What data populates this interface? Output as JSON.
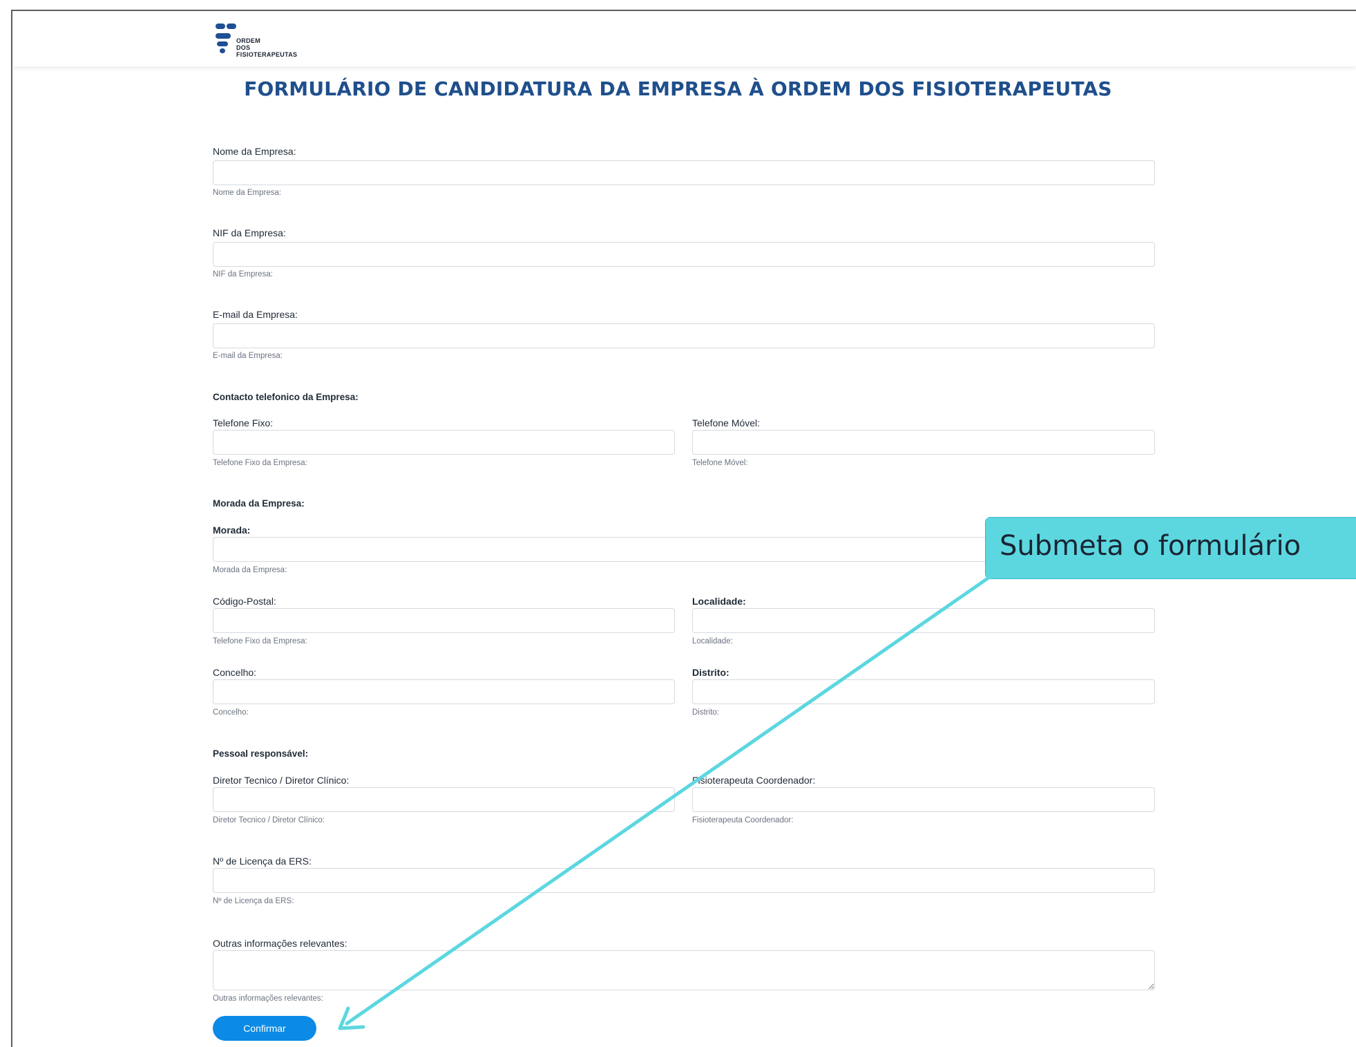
{
  "brand": {
    "logo_line1": "ORDEM",
    "logo_line2": "DOS",
    "logo_line3": "FISIOTERAPEUTAS"
  },
  "page": {
    "title": "FORMULÁRIO DE CANDIDATURA DA EMPRESA À ORDEM DOS FISIOTERAPEUTAS"
  },
  "form": {
    "nome": {
      "label": "Nome da Empresa:",
      "value": "",
      "help": "Nome da Empresa:"
    },
    "nif": {
      "label": "NIF da Empresa:",
      "value": "",
      "help": "NIF da Empresa:"
    },
    "email": {
      "label": "E-mail da Empresa:",
      "value": "",
      "help": "E-mail da Empresa:"
    },
    "contacto_section": "Contacto telefonico da Empresa:",
    "telefone_fixo": {
      "label": "Telefone Fixo:",
      "value": "",
      "help": "Telefone Fixo da Empresa:"
    },
    "telefone_movel": {
      "label": "Telefone Móvel:",
      "value": "",
      "help": "Telefone Móvel:"
    },
    "morada_section": "Morada da Empresa:",
    "morada": {
      "label": "Morada:",
      "value": "",
      "help": "Morada da Empresa:"
    },
    "codigo_postal": {
      "label": "Código-Postal:",
      "value": "",
      "help": "Telefone Fixo da Empresa:"
    },
    "localidade": {
      "label": "Localidade:",
      "value": "",
      "help": "Localidade:"
    },
    "concelho": {
      "label": "Concelho:",
      "value": "",
      "help": "Concelho:"
    },
    "distrito": {
      "label": "Distrito:",
      "value": "",
      "help": "Distrito:"
    },
    "pessoal_section": "Pessoal responsável:",
    "diretor": {
      "label": "Diretor Tecnico / Diretor Clínico:",
      "value": "",
      "help": "Diretor Tecnico / Diretor Clínico:"
    },
    "fisioterapeuta": {
      "label": "Fisioterapeuta Coordenador:",
      "value": "",
      "help": "Fisioterapeuta Coordenador:"
    },
    "licenca": {
      "label": "Nº de Licença da ERS:",
      "value": "",
      "help": "Nº de Licença da ERS:"
    },
    "outras": {
      "label": "Outras informações relevantes:",
      "value": "",
      "help": "Outras informações relevantes:"
    },
    "confirm_label": "Confirmar"
  },
  "annotation": {
    "callout_text": "Submeta o formulário"
  },
  "colors": {
    "title": "#1f4f8c",
    "button": "#0b8ae6",
    "callout": "#5cd7e0",
    "arrow": "#5cd7e0"
  }
}
